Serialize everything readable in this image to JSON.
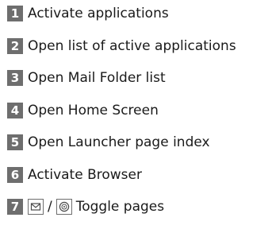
{
  "items": [
    {
      "number": "1",
      "label": "Activate applications"
    },
    {
      "number": "2",
      "label": "Open list of active applications"
    },
    {
      "number": "3",
      "label": "Open Mail Folder list"
    },
    {
      "number": "4",
      "label": "Open Home Screen"
    },
    {
      "number": "5",
      "label": "Open Launcher page index"
    },
    {
      "number": "6",
      "label": "Activate Browser"
    },
    {
      "number": "7",
      "separator": "/",
      "label": "Toggle pages",
      "icons": [
        "mail-key-icon",
        "browser-key-icon"
      ]
    }
  ],
  "colors": {
    "badge_background": "#6e6e6e",
    "badge_text": "#ffffff",
    "text": "#1a1a1a"
  }
}
